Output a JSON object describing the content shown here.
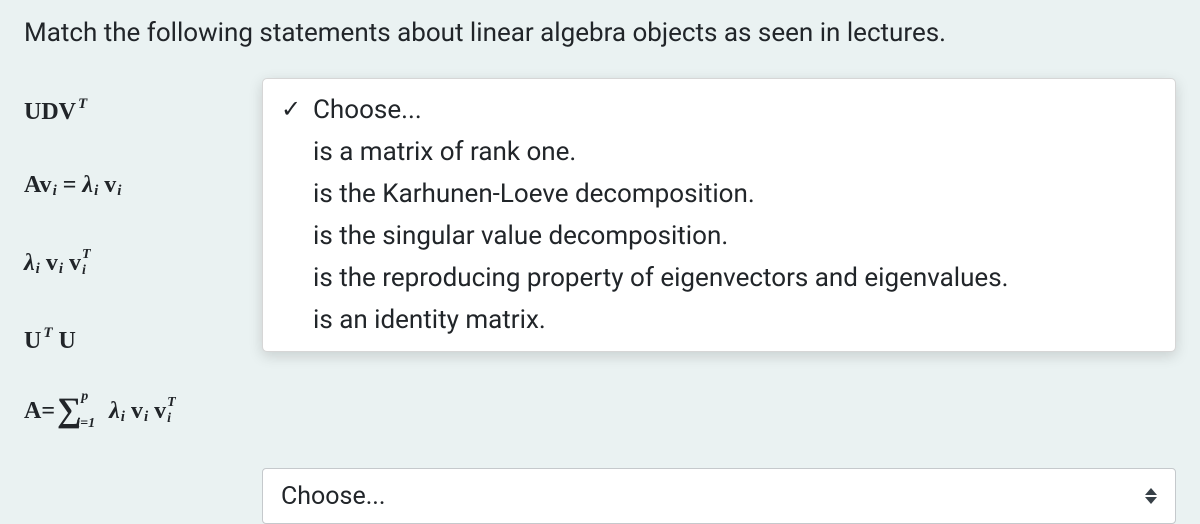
{
  "prompt": "Match the following statements about linear algebra objects as seen in lectures.",
  "terms": [
    {
      "label_plain": "UDV^T"
    },
    {
      "label_plain": "Av_i = λ_i v_i"
    },
    {
      "label_plain": "λ_i v_i v_i^T"
    },
    {
      "label_plain": "U^T U"
    },
    {
      "label_plain": "A = Σ_{i=1}^{p} λ_i v_i v_i^T"
    }
  ],
  "dropdown": {
    "selected_label": "Choose...",
    "options": [
      "Choose...",
      "is a matrix of rank one.",
      "is the Karhunen-Loeve decomposition.",
      "is the singular value decomposition.",
      "is the reproducing property of eigenvectors and eigenvalues.",
      "is an identity matrix."
    ]
  },
  "closed_select": {
    "label": "Choose..."
  }
}
